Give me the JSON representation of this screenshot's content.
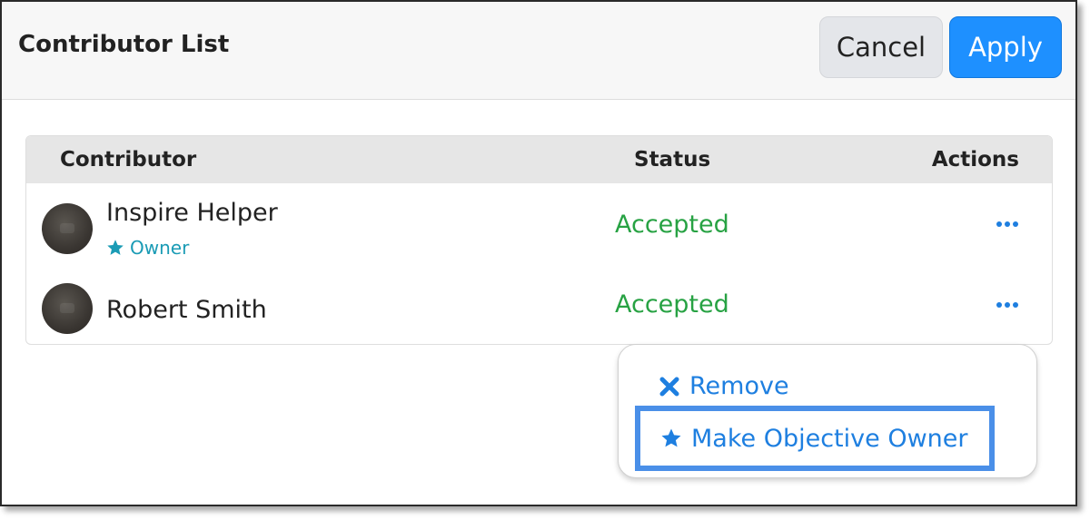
{
  "dialog": {
    "title": "Contributor List",
    "cancel_label": "Cancel",
    "apply_label": "Apply"
  },
  "table": {
    "headers": {
      "contributor": "Contributor",
      "status": "Status",
      "actions": "Actions"
    },
    "rows": [
      {
        "name": "Inspire Helper",
        "role": "Owner",
        "status": "Accepted"
      },
      {
        "name": "Robert Smith",
        "status": "Accepted"
      }
    ]
  },
  "menu": {
    "items": [
      {
        "label": "Remove",
        "icon": "close-icon"
      },
      {
        "label": "Make Objective Owner",
        "icon": "star-icon"
      }
    ]
  },
  "colors": {
    "accent": "#1e90ff",
    "status_accepted": "#27a243",
    "owner_badge": "#1a9bb5"
  }
}
